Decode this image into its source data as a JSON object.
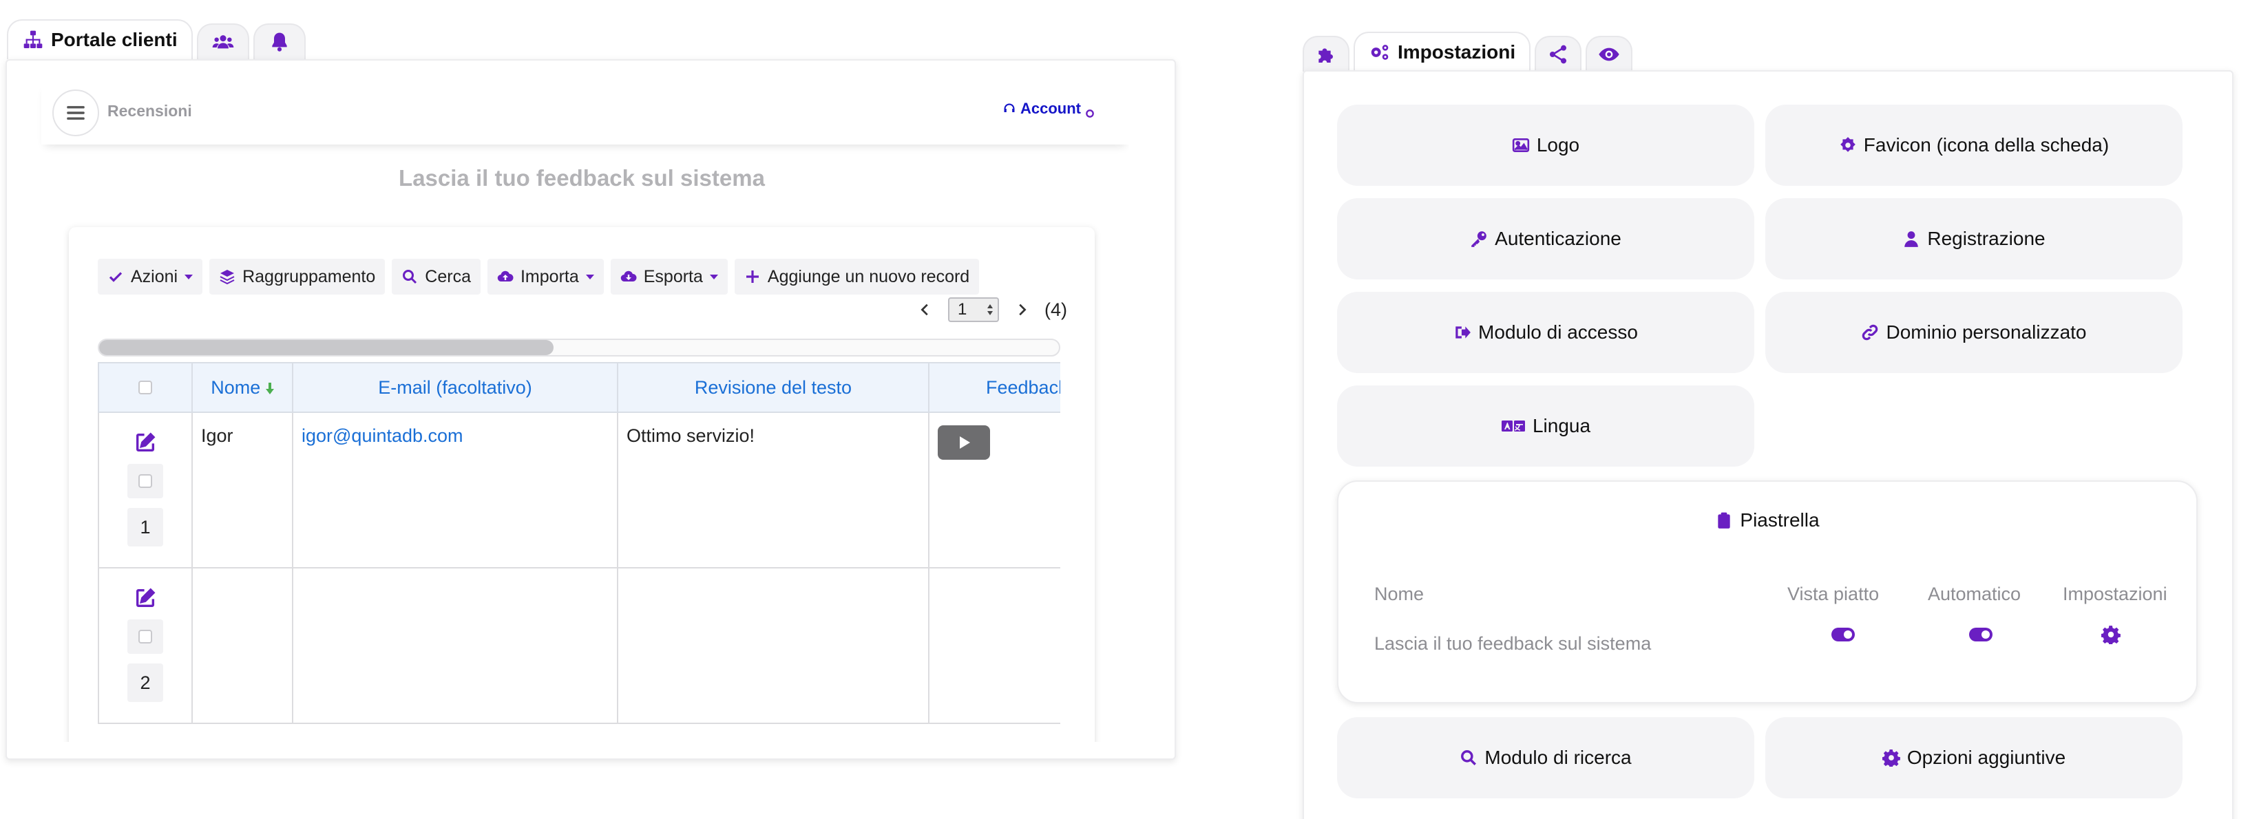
{
  "left_tabs": {
    "portal_label": "Portale clienti",
    "icons": [
      "sitemap-icon",
      "users-icon",
      "bell-icon"
    ]
  },
  "app": {
    "brand_label": "Recensioni",
    "account_label": "Account",
    "page_heading": "Lascia il tuo feedback sul sistema"
  },
  "toolbar": {
    "actions": "Azioni",
    "grouping": "Raggruppamento",
    "search": "Cerca",
    "import": "Importa",
    "export": "Esporta",
    "add_record": "Aggiunge un nuovo record"
  },
  "pager": {
    "current_page": "1",
    "total": "(4)"
  },
  "table": {
    "columns": [
      "Nome",
      "E-mail (facoltativo)",
      "Revisione del testo",
      "Feedback"
    ],
    "rows": [
      {
        "num": "1",
        "nome": "Igor",
        "email": "igor@quintadb.com",
        "revisione": "Ottimo servizio!"
      },
      {
        "num": "2",
        "nome": "",
        "email": "",
        "revisione": ""
      }
    ]
  },
  "right_tabs": {
    "settings_label": "Impostazioni",
    "icons": [
      "puzzle-icon",
      "gears-icon",
      "share-icon",
      "eye-icon"
    ]
  },
  "settings": {
    "logo": "Logo",
    "favicon": "Favicon (icona della scheda)",
    "auth": "Autenticazione",
    "registration": "Registrazione",
    "login_form": "Modulo di accesso",
    "custom_domain": "Dominio personalizzato",
    "language": "Lingua",
    "search_form": "Modulo di ricerca",
    "extra_options": "Opzioni aggiuntive"
  },
  "tile": {
    "title": "Piastrella",
    "col_name": "Nome",
    "col_flat": "Vista piatto",
    "col_auto": "Automatico",
    "col_settings": "Impostazioni",
    "row_name": "Lascia il tuo feedback sul sistema",
    "flat_on": true,
    "auto_on": true
  },
  "colors": {
    "accent": "#6a1fc2",
    "link": "#1a6fd6",
    "account_link": "#1515c8"
  }
}
